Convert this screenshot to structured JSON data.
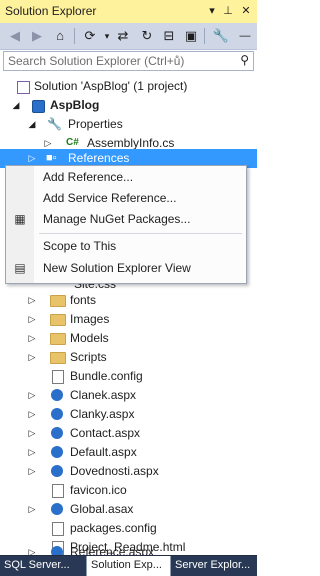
{
  "window": {
    "title": "Solution Explorer",
    "pin_icon": "pin-icon",
    "dropdown_icon": "window-position-dropdown-icon",
    "close_icon": "close-icon"
  },
  "toolbar": {
    "icons": [
      "back-icon",
      "forward-icon",
      "home-icon",
      "pending-changes-filter-icon",
      "sync-with-active-document-icon",
      "refresh-icon",
      "collapse-all-icon",
      "show-all-files-icon",
      "properties-icon"
    ]
  },
  "search": {
    "placeholder": "Search Solution Explorer (Ctrl+ů)",
    "icon": "search-icon"
  },
  "tree": {
    "solution": "Solution 'AspBlog' (1 project)",
    "project": "AspBlog",
    "properties": "Properties",
    "assemblyinfo": "AssemblyInfo.cs",
    "references": "References",
    "partial_item": "Site.css",
    "items": [
      "fonts",
      "Images",
      "Models",
      "Scripts",
      "Bundle.config",
      "Clanek.aspx",
      "Clanky.aspx",
      "Contact.aspx",
      "Default.aspx",
      "Dovednosti.aspx",
      "favicon.ico",
      "Global.asax",
      "packages.config",
      "Project_Readme.html",
      "Reference.aspx"
    ]
  },
  "context_menu": {
    "add_reference": "Add Reference...",
    "add_service_reference": "Add Service Reference...",
    "manage_nuget": "Manage NuGet Packages...",
    "scope_to_this": "Scope to This",
    "new_solution_explorer_view": "New Solution Explorer View"
  },
  "tabs": [
    "SQL Server...",
    "Solution Exp...",
    "Server Explor..."
  ],
  "colors": {
    "selection": "#3399ff",
    "title_bar": "#fff29d",
    "tab_strip": "#293955"
  }
}
